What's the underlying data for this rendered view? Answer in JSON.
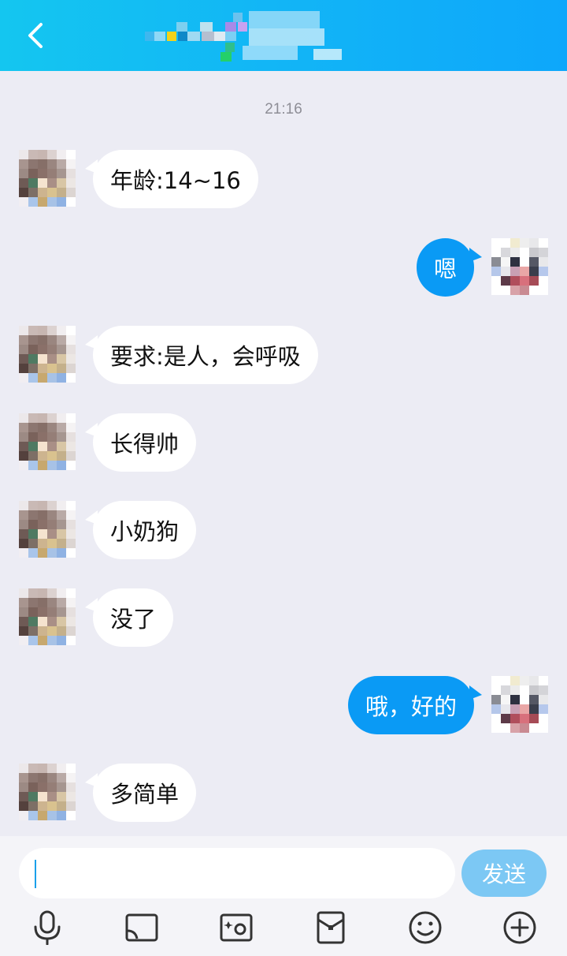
{
  "header": {
    "back_icon": "chevron-left-icon"
  },
  "timestamp": "21:16",
  "messages": [
    {
      "side": "left",
      "text": "年龄:14~16"
    },
    {
      "side": "right",
      "text": "嗯"
    },
    {
      "side": "left",
      "text": "要求:是人，会呼吸"
    },
    {
      "side": "left",
      "text": "长得帅"
    },
    {
      "side": "left",
      "text": "小奶狗"
    },
    {
      "side": "left",
      "text": "没了"
    },
    {
      "side": "right",
      "text": "哦，好的"
    },
    {
      "side": "left",
      "text": "多简单"
    }
  ],
  "input": {
    "value": "",
    "send_label": "发送"
  },
  "toolbar": {
    "icons": [
      "microphone-icon",
      "screen-cast-icon",
      "photo-icon",
      "red-packet-icon",
      "emoji-icon",
      "plus-icon"
    ]
  },
  "colors": {
    "header_start": "#14c6f0",
    "header_end": "#0ea7fb",
    "chat_background": "#ececf4",
    "outgoing_bubble": "#0a9af5",
    "incoming_bubble": "#ffffff",
    "send_button": "#7cc8f4"
  }
}
